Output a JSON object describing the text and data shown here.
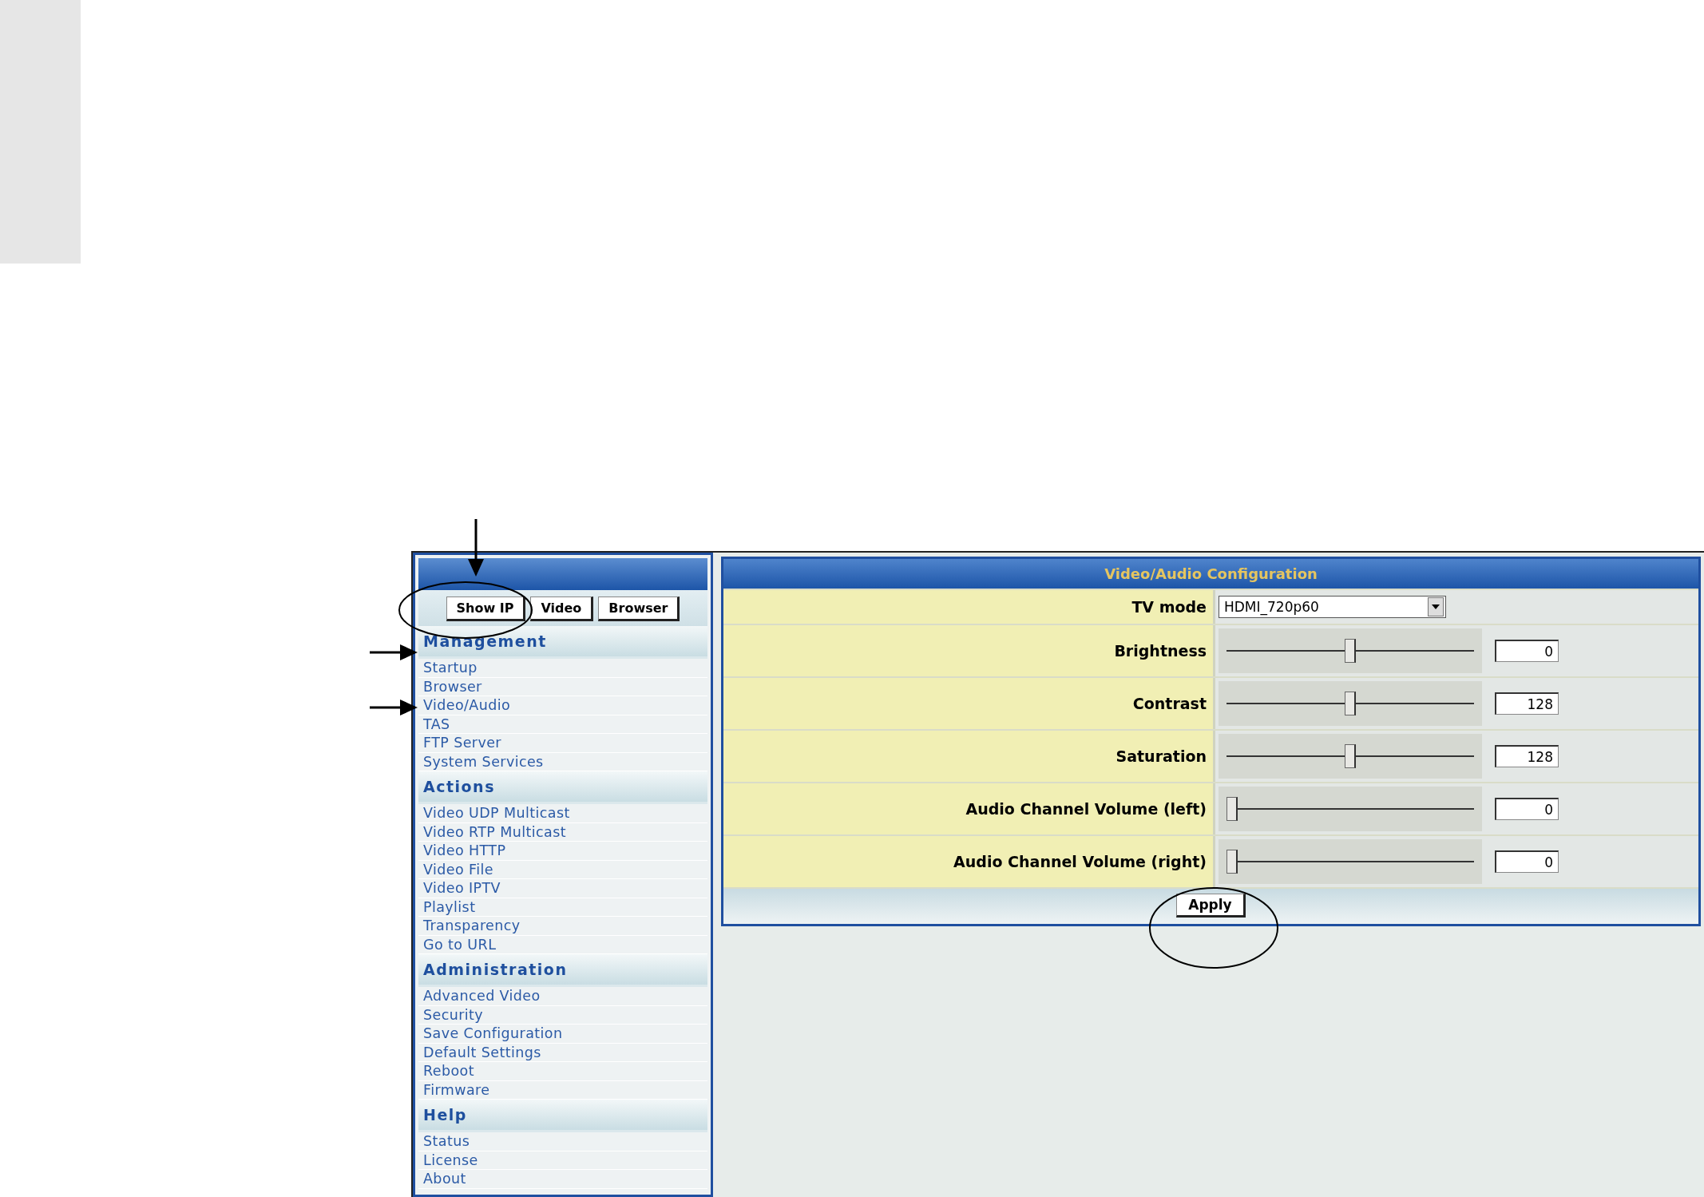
{
  "sidebar": {
    "buttons": [
      "Show IP",
      "Video",
      "Browser"
    ],
    "sections": [
      {
        "title": "Management",
        "items": [
          "Startup",
          "Browser",
          "Video/Audio",
          "TAS",
          "FTP Server",
          "System Services"
        ]
      },
      {
        "title": "Actions",
        "items": [
          "Video UDP Multicast",
          "Video RTP Multicast",
          "Video HTTP",
          "Video File",
          "Video IPTV",
          "Playlist",
          "Transparency",
          "Go to URL"
        ]
      },
      {
        "title": "Administration",
        "items": [
          "Advanced Video",
          "Security",
          "Save Configuration",
          "Default Settings",
          "Reboot",
          "Firmware"
        ]
      },
      {
        "title": "Help",
        "items": [
          "Status",
          "License",
          "About"
        ]
      }
    ]
  },
  "panel": {
    "title": "Video/Audio Configuration",
    "rows": [
      {
        "kind": "select",
        "label": "TV mode",
        "value": "HDMI_720p60"
      },
      {
        "kind": "slider",
        "label": "Brightness",
        "level": 0.5,
        "value": "0"
      },
      {
        "kind": "slider",
        "label": "Contrast",
        "level": 0.5,
        "value": "128"
      },
      {
        "kind": "slider",
        "label": "Saturation",
        "level": 0.5,
        "value": "128"
      },
      {
        "kind": "slider",
        "label": "Audio Channel Volume (left)",
        "level": 0,
        "value": "0"
      },
      {
        "kind": "slider",
        "label": "Audio Channel Volume (right)",
        "level": 0,
        "value": "0"
      }
    ],
    "apply": "Apply"
  }
}
